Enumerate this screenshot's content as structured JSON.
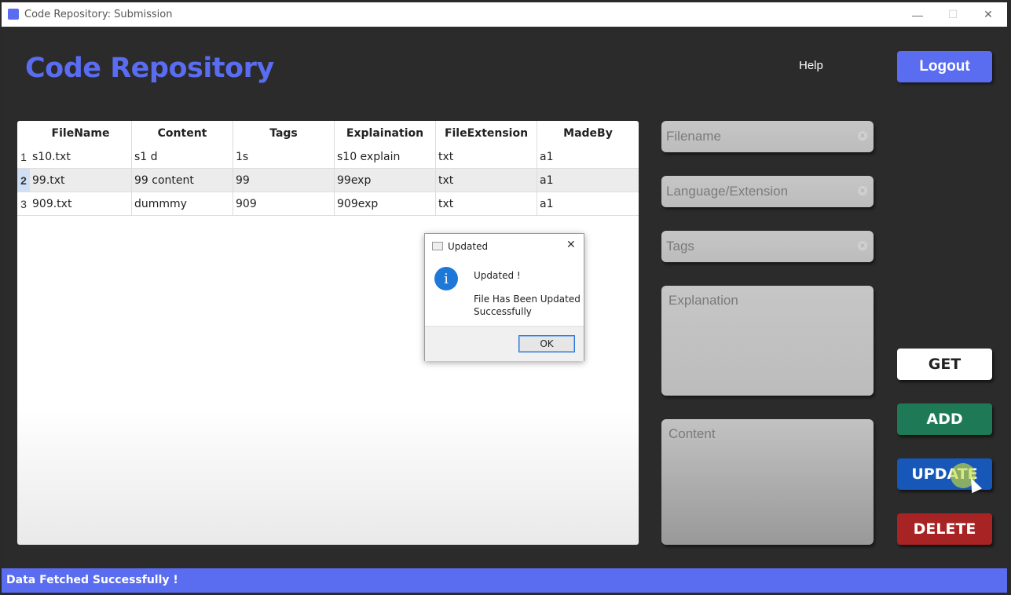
{
  "window": {
    "title": "Code Repository: Submission",
    "controls": {
      "minimize": "—",
      "maximize": "☐",
      "close": "✕"
    }
  },
  "header": {
    "app_title": "Code Repository",
    "help_label": "Help",
    "logout_label": "Logout"
  },
  "table": {
    "columns": [
      "FileName",
      "Content",
      "Tags",
      "Explaination",
      "FileExtension",
      "MadeBy"
    ],
    "rows": [
      {
        "index": "1",
        "cells": [
          "s10.txt",
          "s1 d",
          "1s",
          "s10 explain",
          "txt",
          "a1"
        ]
      },
      {
        "index": "2",
        "cells": [
          "99.txt",
          "99 content",
          "99",
          "99exp",
          "txt",
          "a1"
        ]
      },
      {
        "index": "3",
        "cells": [
          "909.txt",
          "dummmy",
          "909",
          "909exp",
          "txt",
          "a1"
        ]
      }
    ],
    "selected_row": "2"
  },
  "form": {
    "filename_placeholder": "Filename",
    "language_placeholder": "Language/Extension",
    "tags_placeholder": "Tags",
    "explanation_placeholder": "Explanation",
    "content_placeholder": "Content"
  },
  "actions": {
    "get_label": "GET",
    "add_label": "ADD",
    "update_label": "UPDATE",
    "delete_label": "DELETE"
  },
  "status": {
    "message": "Data Fetched Successfully !"
  },
  "dialog": {
    "title": "Updated",
    "close_glyph": "✕",
    "icon": "info-icon",
    "heading": "Updated !",
    "message": "File Has Been Updated Successfully",
    "ok_label": "OK"
  },
  "colors": {
    "accent": "#5a6cf0",
    "add": "#1e7a56",
    "update": "#1657b8",
    "delete": "#a82424"
  }
}
